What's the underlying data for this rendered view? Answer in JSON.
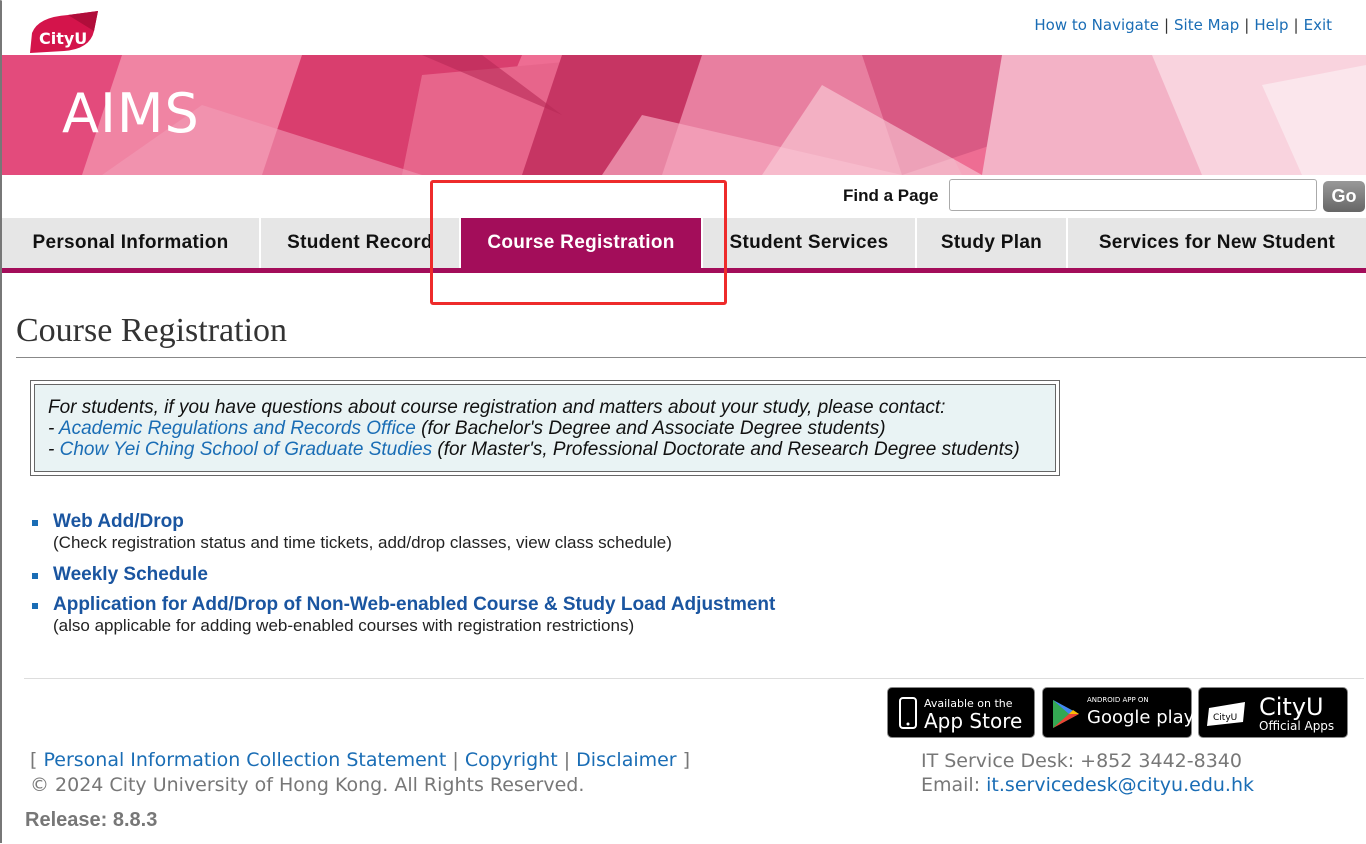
{
  "header": {
    "logo_text": "CityU",
    "links": [
      "How to Navigate",
      "Site Map",
      "Help",
      "Exit"
    ],
    "separator": "|"
  },
  "banner": {
    "title": "AIMS"
  },
  "search": {
    "label": "Find a Page",
    "value": "",
    "button": "Go"
  },
  "nav": {
    "tabs": [
      "Personal Information",
      "Student Record",
      "Course Registration",
      "Student Services",
      "Study Plan",
      "Services for New Student"
    ],
    "active": "Course Registration"
  },
  "page": {
    "title": "Course Registration"
  },
  "notice": {
    "intro": "For students, if you have questions about course registration and matters about your study, please contact:",
    "dash": "- ",
    "line1_link": "Academic Regulations and Records Office",
    "line1_text": " (for Bachelor's Degree and Associate Degree students)",
    "line2_link": "Chow Yei Ching School of Graduate Studies",
    "line2_text": " (for Master's, Professional Doctorate and Research Degree students)"
  },
  "links": [
    {
      "label": "Web Add/Drop",
      "desc": "(Check registration status and time tickets, add/drop classes, view class schedule)"
    },
    {
      "label": "Weekly Schedule",
      "desc": ""
    },
    {
      "label": "Application for Add/Drop of Non-Web-enabled Course & Study Load Adjustment",
      "desc": "(also applicable for adding web-enabled courses with registration restrictions)"
    }
  ],
  "badges": {
    "appstore_small": "Available on the",
    "appstore_big": "App Store",
    "google_small": "ANDROID APP ON",
    "google_big": "Google play",
    "cityu_logo": "CityU",
    "cityu_big": "CityU",
    "cityu_small": "Official Apps"
  },
  "footer": {
    "open_bracket": "[",
    "close_bracket": "]",
    "sep": "|",
    "links": [
      "Personal Information Collection Statement",
      "Copyright",
      "Disclaimer"
    ],
    "copyright": "© 2024 City University of Hong Kong. All Rights Reserved.",
    "release": "Release: 8.8.3",
    "service_desk": "IT Service Desk: +852 3442-8340",
    "email_label": "Email: ",
    "email": "it.servicedesk@cityu.edu.hk"
  },
  "colors": {
    "accent": "#a30d5a",
    "link": "#1a6db5",
    "highlight": "#ee2b2b"
  }
}
